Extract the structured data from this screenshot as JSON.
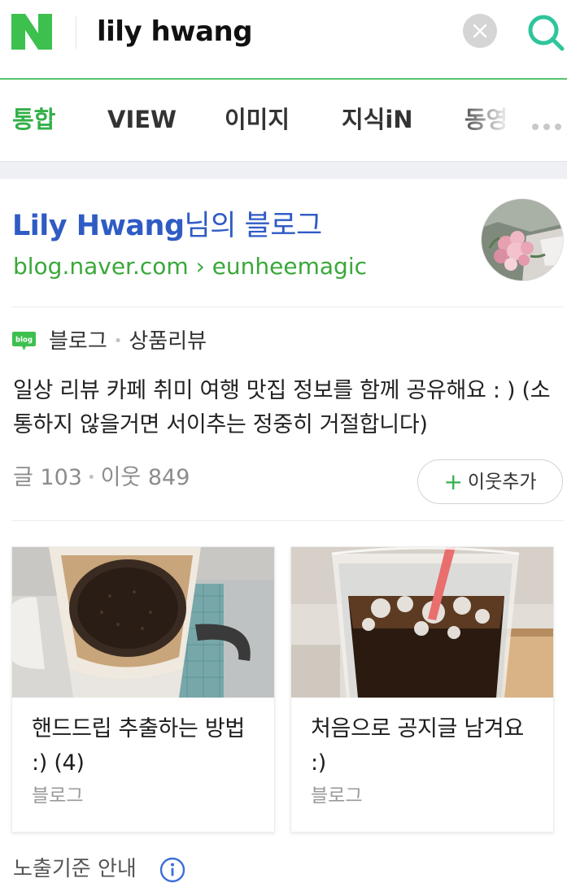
{
  "search": {
    "query": "lily hwang",
    "brand_color": "#03c75a"
  },
  "tabs": [
    {
      "label": "통합",
      "active": true
    },
    {
      "label": "VIEW",
      "active": false
    },
    {
      "label": "이미지",
      "active": false
    },
    {
      "label": "지식iN",
      "active": false
    },
    {
      "label": "동영",
      "active": false
    }
  ],
  "profile": {
    "name": "Lily Hwang",
    "title_suffix": "님의 블로그",
    "url": "blog.naver.com › eunheemagic",
    "avatar_icon": "flower-bouquet-photo"
  },
  "blog": {
    "badge": "blog",
    "category1": "블로그",
    "category2": "상품리뷰",
    "description": "일상 리뷰 카페 취미 여행 맛집 정보를 함께 공유해요 : ) (소통하지 않을거면 서이추는 정중히 거절합니다)",
    "posts_label": "글 103",
    "neighbors_label": "이웃 849",
    "follow_label": "이웃추가"
  },
  "posts": [
    {
      "title": "핸드드립 추출하는 방법 :) (4)",
      "source": "블로그",
      "thumb_icon": "hand-drip-coffee-photo"
    },
    {
      "title": "처음으로 공지글 남겨요 :)",
      "source": "블로그",
      "thumb_icon": "iced-coffee-photo"
    }
  ],
  "footer": {
    "notice": "노출기준 안내"
  }
}
